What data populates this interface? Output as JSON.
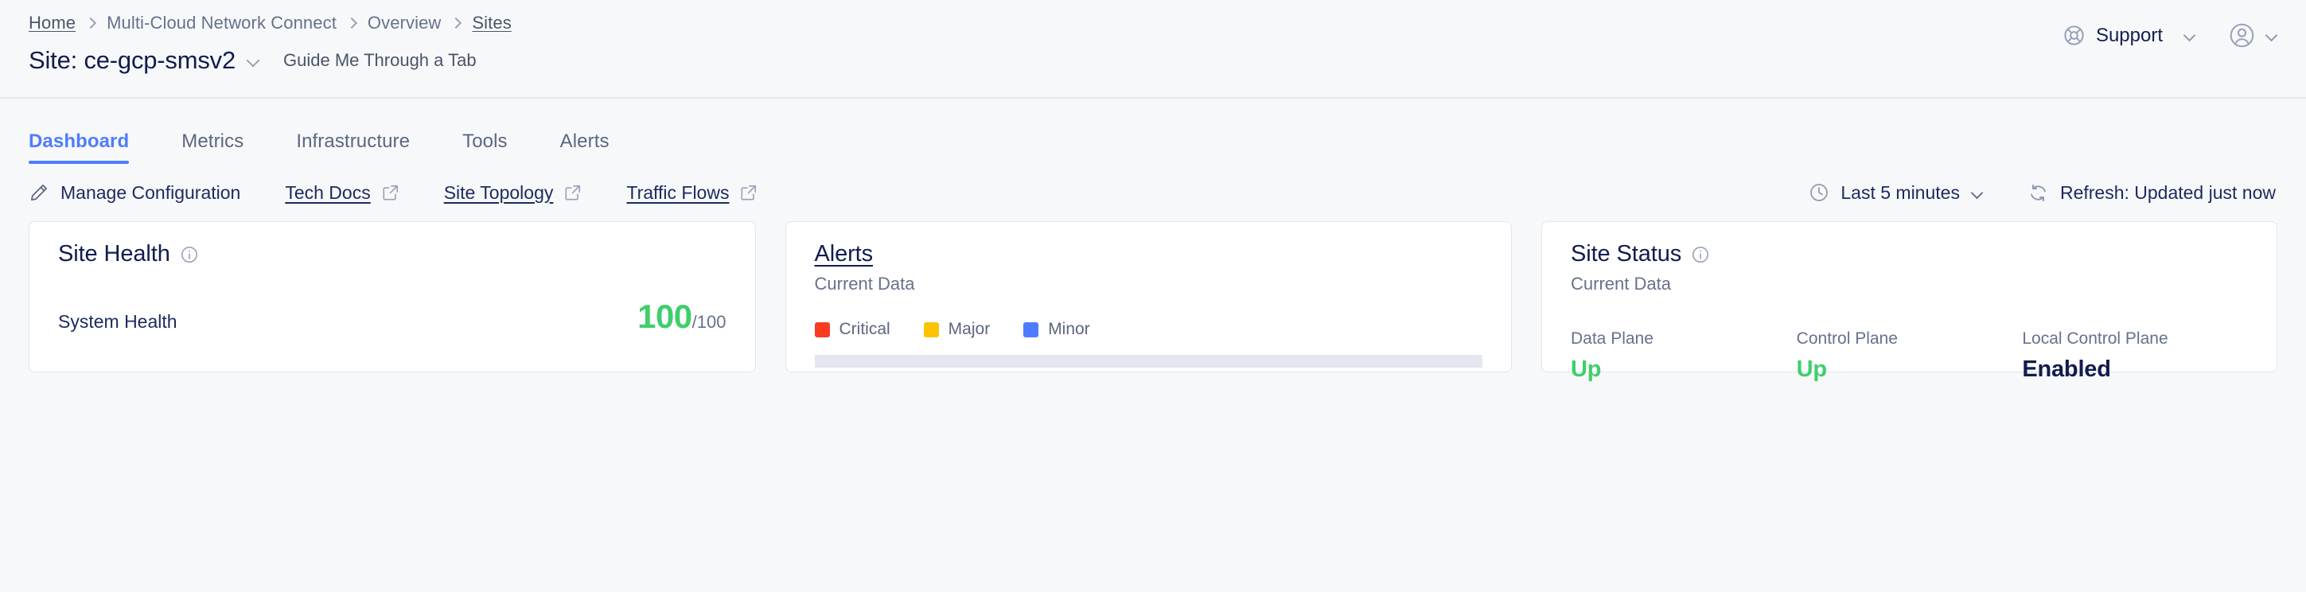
{
  "breadcrumb": {
    "items": [
      {
        "label": "Home",
        "is_link": true
      },
      {
        "label": "Multi-Cloud Network Connect",
        "is_link": false
      },
      {
        "label": "Overview",
        "is_link": false
      },
      {
        "label": "Sites",
        "is_link": true
      }
    ]
  },
  "header": {
    "title_label": "Site:",
    "title_value": "ce-gcp-smsv2",
    "guide_link": "Guide Me Through a Tab",
    "support_label": "Support",
    "support_icon": "lifebuoy-icon",
    "avatar_icon": "user-avatar-icon",
    "chevron_icon": "chevron-down-icon"
  },
  "tabs": [
    {
      "label": "Dashboard",
      "active": true
    },
    {
      "label": "Metrics",
      "active": false
    },
    {
      "label": "Infrastructure",
      "active": false
    },
    {
      "label": "Tools",
      "active": false
    },
    {
      "label": "Alerts",
      "active": false
    }
  ],
  "actionbar": {
    "manage_configuration": "Manage Configuration",
    "manage_configuration_icon": "pencil-icon",
    "tech_docs": "Tech Docs",
    "site_topology": "Site Topology",
    "traffic_flows": "Traffic Flows",
    "external_link_icon": "external-link-icon",
    "time_range": "Last 5 minutes",
    "time_range_icon": "clock-icon",
    "refresh": "Refresh: Updated just now",
    "refresh_icon": "refresh-icon"
  },
  "cards": {
    "site_health": {
      "title": "Site Health",
      "info_icon": "info-icon",
      "metric_label": "System Health",
      "score": "100",
      "denominator": "/100",
      "score_color": "#3ecf6b"
    },
    "alerts": {
      "title": "Alerts",
      "subtitle": "Current Data",
      "legend": [
        {
          "label": "Critical",
          "color": "#f93b21"
        },
        {
          "label": "Major",
          "color": "#fdc300"
        },
        {
          "label": "Minor",
          "color": "#4d7cfe"
        }
      ]
    },
    "site_status": {
      "title": "Site Status",
      "info_icon": "info-icon",
      "subtitle": "Current Data",
      "items": [
        {
          "label": "Data Plane",
          "value": "Up",
          "color": "#3ecf6b"
        },
        {
          "label": "Control Plane",
          "value": "Up",
          "color": "#3ecf6b"
        },
        {
          "label": "Local Control Plane",
          "value": "Enabled",
          "color": "#111c4e"
        }
      ]
    }
  },
  "chart_data": {
    "type": "bar",
    "title": "Alerts",
    "subtitle": "Current Data",
    "categories": [],
    "series": [
      {
        "name": "Critical",
        "color": "#f93b21",
        "values": []
      },
      {
        "name": "Major",
        "color": "#fdc300",
        "values": []
      },
      {
        "name": "Minor",
        "color": "#4d7cfe",
        "values": []
      }
    ],
    "xlabel": "",
    "ylabel": "",
    "grid": false,
    "legend_position": "top",
    "note": "No alert data plotted; empty axis baseline shown"
  }
}
